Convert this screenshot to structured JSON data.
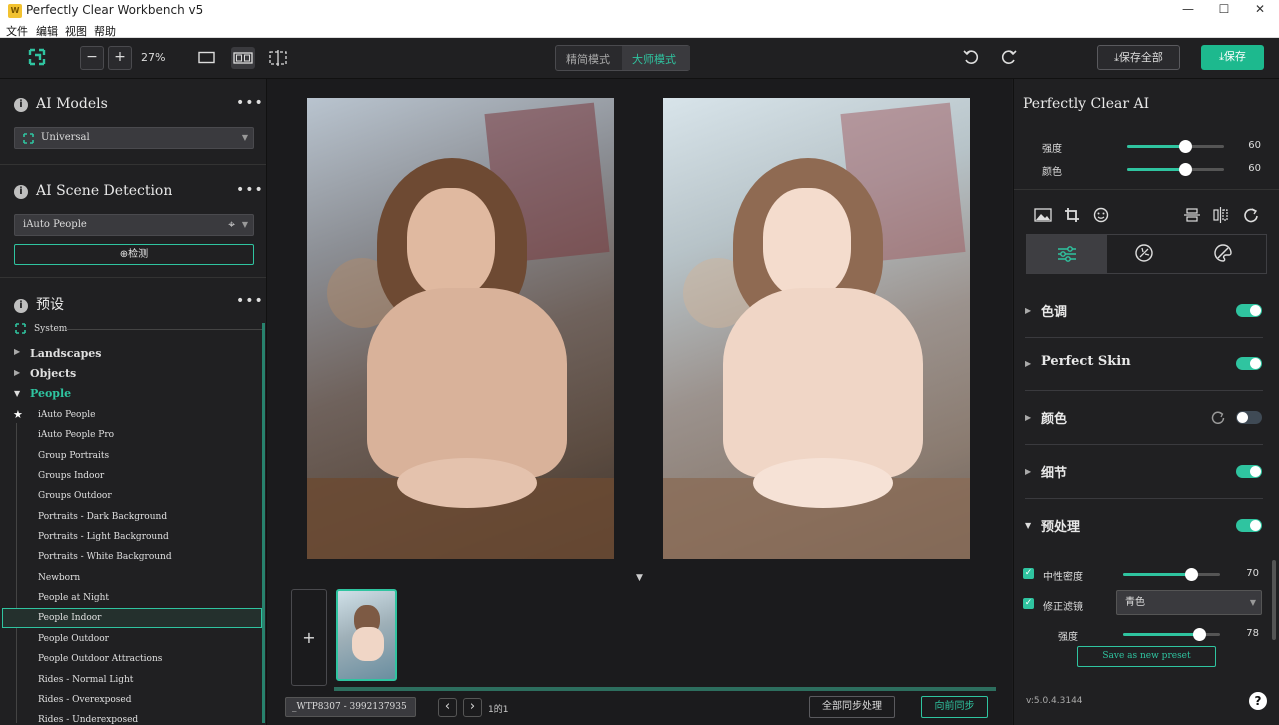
{
  "window": {
    "title": "Perfectly Clear Workbench v5",
    "min": "—",
    "max": "☐",
    "close": "✕",
    "app_icon_text": "W"
  },
  "menu": [
    "文件",
    "编辑",
    "视图",
    "帮助"
  ],
  "toolbar": {
    "zoom_minus": "−",
    "zoom_plus": "+",
    "zoom_level": "27%",
    "mode_simple": "精简模式",
    "mode_master": "大师模式",
    "save_all": "⤓保存全部",
    "save": "⤓保存"
  },
  "left": {
    "ai_models": {
      "title": "AI Models",
      "more": "•••",
      "selected": "Universal"
    },
    "scene": {
      "title": "AI Scene Detection",
      "more": "•••",
      "selected": "iAuto People",
      "detect_button": "⊕检测"
    },
    "presets": {
      "title": "预设",
      "more": "•••",
      "system": "System",
      "categories": [
        {
          "label": "Landscapes",
          "arrow": "▶"
        },
        {
          "label": "Objects",
          "arrow": "▶"
        },
        {
          "label": "People",
          "arrow": "▼"
        }
      ],
      "items": [
        "iAuto People",
        "iAuto People Pro",
        "Group Portraits",
        "Groups Indoor",
        "Groups Outdoor",
        "Portraits - Dark Background",
        "Portraits - Light Background",
        "Portraits - White Background",
        "Newborn",
        "People at Night",
        "People Indoor",
        "People Outdoor",
        "People Outdoor Attractions",
        "Rides - Normal Light",
        "Rides - Overexposed",
        "Rides - Underexposed"
      ],
      "favorite_icon": "★",
      "selected_item": "People Indoor"
    }
  },
  "center": {
    "add_button": "+",
    "collapse_arrow": "▼",
    "file_select": "_WTP8307 - 3992137935",
    "page_indicator": "1的1",
    "prev": "‹",
    "next": "›",
    "sync_all": "全部同步处理",
    "sync_forward": "向前同步"
  },
  "right": {
    "title": "Perfectly Clear AI",
    "strength_label": "强度",
    "strength_value": "60",
    "strength_level": 0.6,
    "color_label": "颜色",
    "color_value": "60",
    "color_level": 0.6,
    "sections": [
      {
        "label": "色调",
        "on": true
      },
      {
        "label": "Perfect Skin",
        "on": true
      },
      {
        "label": "颜色",
        "on": false
      },
      {
        "label": "细节",
        "on": true
      },
      {
        "label": "预处理",
        "on": true
      }
    ],
    "pre": {
      "neutral_label": "中性密度",
      "neutral_value": "70",
      "neutral_level": 0.7,
      "filter_label": "修正滤镜",
      "filter_selected": "青色",
      "intensity_label": "强度",
      "intensity_value": "78",
      "intensity_level": 0.78,
      "save_preset": "Save as new preset"
    },
    "version": "v:5.0.4.3144",
    "help": "?"
  },
  "colors": {
    "accent": "#2fc4a0",
    "save_bg": "#1db98e",
    "panel": "#202022"
  }
}
